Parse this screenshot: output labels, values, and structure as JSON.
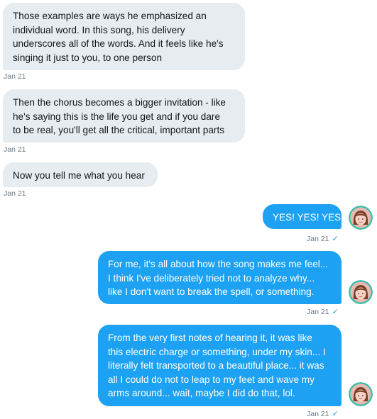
{
  "messages": [
    {
      "direction": "in",
      "lines": [
        "Those examples are ways he emphasized an",
        "individual word. In this song, his delivery",
        "underscores all of the words. And it feels like he's",
        "singing it just to you, to one person"
      ],
      "time": "Jan 21"
    },
    {
      "direction": "in",
      "lines": [
        "Then the chorus becomes a bigger invitation - like",
        "he's saying this is the life you get and if you dare",
        "to be real, you'll get all the critical, important parts"
      ],
      "time": "Jan 21"
    },
    {
      "direction": "in",
      "lines": [
        "Now you tell me what you hear"
      ],
      "time": "Jan 21"
    },
    {
      "direction": "out",
      "lines": [
        "YES! YES! YES!"
      ],
      "time": "Jan 21",
      "read_mark": "✓"
    },
    {
      "direction": "out",
      "lines": [
        "For me, it's all about how the song makes me feel...",
        "I think I've deliberately tried not to analyze why...",
        "like I don't want to break the spell, or something."
      ],
      "time": "Jan 21",
      "read_mark": "✓"
    },
    {
      "direction": "out",
      "lines": [
        "From the very first notes of hearing it, it was like",
        "this electric charge or something, under my skin... I",
        "literally felt transported to a beautiful place... it was",
        "all I could do not to leap to my feet and wave my",
        "arms around... wait, maybe I did do that, lol."
      ],
      "time": "Jan 21",
      "read_mark": "✓"
    }
  ],
  "avatar": {
    "icon": "user-avatar-icon",
    "ring_color": "#3dbfa8",
    "background_color": "#e9b9b4",
    "hair_color": "#7a3f25"
  },
  "colors": {
    "incoming_bubble": "#e6ecf0",
    "outgoing_bubble": "#1da1f2",
    "meta_text": "#657786",
    "read_check": "#1da1f2"
  }
}
